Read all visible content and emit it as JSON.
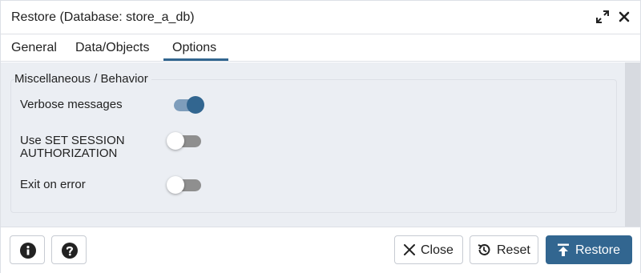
{
  "dialog": {
    "title": "Restore (Database: store_a_db)",
    "expand_icon": "expand-icon",
    "close_icon": "close-icon"
  },
  "tabs": [
    {
      "label": "General",
      "active": false
    },
    {
      "label": "Data/Objects",
      "active": false
    },
    {
      "label": "Options",
      "active": true
    }
  ],
  "section": {
    "legend": "Miscellaneous / Behavior",
    "options": [
      {
        "label_lines": [
          "Verbose messages"
        ],
        "enabled": true
      },
      {
        "label_lines": [
          "Use SET SESSION",
          "AUTHORIZATION"
        ],
        "enabled": false
      },
      {
        "label_lines": [
          "Exit on error"
        ],
        "enabled": false
      }
    ]
  },
  "footer": {
    "info_icon": "info-icon",
    "help_icon": "help-icon",
    "close_label": "Close",
    "reset_label": "Reset",
    "restore_label": "Restore"
  },
  "colors": {
    "accent": "#326690",
    "toggle_on_track": "#7e9dbb",
    "toggle_off_track": "#8f8f8f",
    "content_bg": "#ebeef3"
  }
}
